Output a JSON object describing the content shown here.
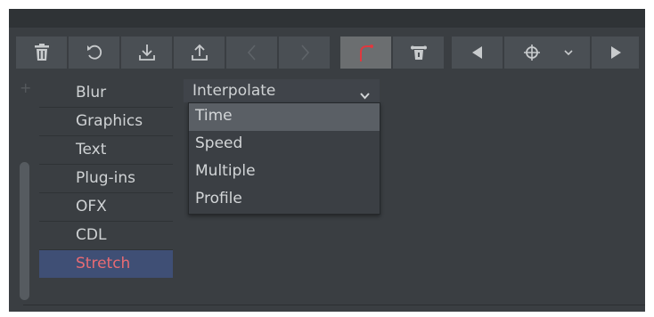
{
  "toolbar": {
    "buttons": [
      {
        "icon": "trash-icon",
        "name": "delete-button"
      },
      {
        "icon": "reset-icon",
        "name": "reset-button"
      },
      {
        "icon": "import-icon",
        "name": "import-button"
      },
      {
        "icon": "export-icon",
        "name": "export-button"
      },
      {
        "icon": "undo-icon",
        "name": "back-button",
        "enabled": false
      },
      {
        "icon": "redo-icon",
        "name": "forward-button",
        "enabled": false
      },
      {
        "icon": "curve-icon",
        "name": "curve-button",
        "active": true
      },
      {
        "icon": "keyframe-lock-icon",
        "name": "keyframe-lock-button"
      },
      {
        "icon": "previous-keyframe-icon",
        "name": "prev-keyframe-button"
      },
      {
        "icon": "crosshair-icon",
        "name": "target-keyframe-button"
      },
      {
        "icon": "chevron-down-icon",
        "name": "keyframe-options-button"
      },
      {
        "icon": "next-keyframe-icon",
        "name": "next-keyframe-button"
      }
    ]
  },
  "sidebar": {
    "items": [
      {
        "label": "Blur"
      },
      {
        "label": "Graphics"
      },
      {
        "label": "Text"
      },
      {
        "label": "Plug-ins"
      },
      {
        "label": "OFX"
      },
      {
        "label": "CDL"
      },
      {
        "label": "Stretch",
        "selected": true
      }
    ]
  },
  "interpolate": {
    "label": "Interpolate",
    "options": [
      {
        "label": "Time",
        "highlighted": true
      },
      {
        "label": "Speed"
      },
      {
        "label": "Multiple"
      },
      {
        "label": "Profile"
      }
    ]
  },
  "colors": {
    "background": "#3a3e42",
    "selection": "#3f4f75",
    "accent_red": "#e86b73",
    "curve_red": "#e0383e"
  }
}
